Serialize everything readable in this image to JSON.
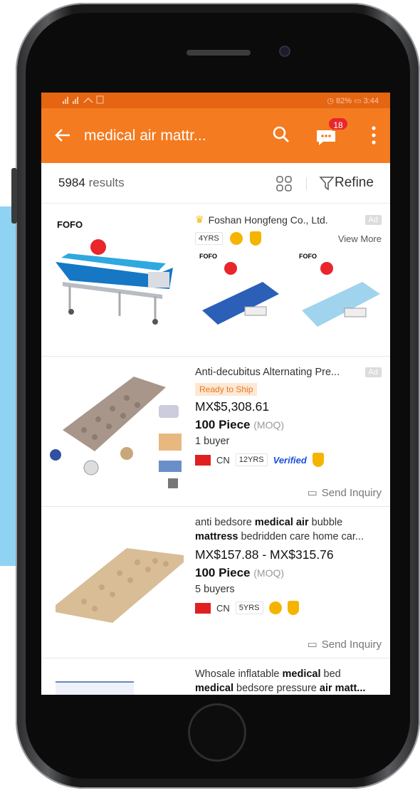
{
  "statusbar": {
    "left_icons": "signal, wifi, NFC",
    "battery": "82%",
    "time": "3:44"
  },
  "appbar": {
    "back_icon": "back-arrow-icon",
    "query": "medical air mattr...",
    "messages_badge": "18"
  },
  "results": {
    "count": "5984",
    "count_word": "results",
    "refine_label": "Refine"
  },
  "ad_card": {
    "supplier": "Foshan Hongfeng Co., Ltd.",
    "ad_label": "Ad",
    "years": "4YRS",
    "view_more": "View More"
  },
  "products": [
    {
      "title": "Anti-decubitus Alternating Pre...",
      "ad_label": "Ad",
      "ready": "Ready to Ship",
      "price": "MX$5,308.61",
      "moq": "100 Piece",
      "moq_note": "(MOQ)",
      "buyers": "1 buyer",
      "country": "CN",
      "years": "12YRS",
      "verified": "Verified",
      "inquiry": "Send Inquiry"
    },
    {
      "title_pre": "anti bedsore ",
      "title_bold1": "medical air",
      "title_mid": " bubble",
      "title_line2_bold": "mattress",
      "title_line2": " bedridden care home car...",
      "price": "MX$157.88 - MX$315.76",
      "moq": "100 Piece",
      "moq_note": "(MOQ)",
      "buyers": "5 buyers",
      "country": "CN",
      "years": "5YRS",
      "inquiry": "Send Inquiry"
    },
    {
      "title_pre": "Whosale inflatable ",
      "title_bold1": "medical",
      "title_mid": " bed",
      "title_line2_bold": "medical",
      "title_line2_mid": " bedsore pressure ",
      "title_line2_bold2": "air matt..."
    }
  ],
  "thumb_texts": {
    "fofo_logo": "FOFO"
  },
  "colors": {
    "orange": "#f47b20",
    "status": "#e56512",
    "badge": "#e8262b",
    "gold": "#f5b400",
    "blue": "#1c4fd8"
  }
}
